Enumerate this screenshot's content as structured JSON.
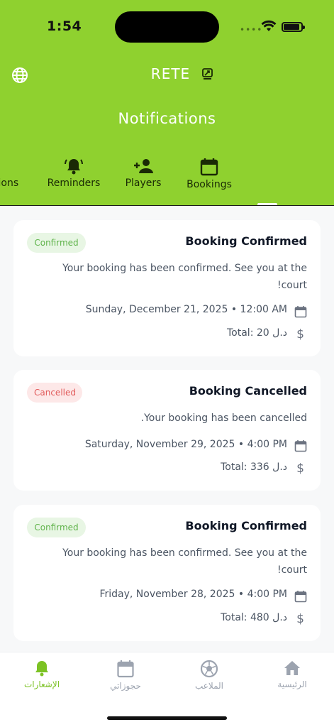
{
  "status_bar": {
    "time": "1:54"
  },
  "header": {
    "app_title": "RETE",
    "page_title": "Notifications",
    "accent_color": "#8fd12f"
  },
  "tabs": [
    {
      "label": "tions",
      "icon": "notifications-icon",
      "partial": true
    },
    {
      "label": "Reminders",
      "icon": "bell-ring-icon"
    },
    {
      "label": "Players",
      "icon": "person-add-icon"
    },
    {
      "label": "Bookings",
      "icon": "calendar-icon"
    }
  ],
  "notifications": [
    {
      "badge": "Confirmed",
      "title": "Booking Confirmed",
      "message": "Your booking has been confirmed. See you at the court!",
      "date": "Sunday, December 21, 2025 • 12:00 AM",
      "total": "Total: 20 د.ل"
    },
    {
      "badge": "Cancelled",
      "title": "Booking Cancelled",
      "message": "Your booking has been cancelled.",
      "date": "Saturday, November 29, 2025 • 4:00 PM",
      "total": "Total: 336 د.ل"
    },
    {
      "badge": "Confirmed",
      "title": "Booking Confirmed",
      "message": "Your booking has been confirmed. See you at the court!",
      "date": "Friday, November 28, 2025 • 4:00 PM",
      "total": "Total: 480 د.ل"
    }
  ],
  "bottom_nav": [
    {
      "label": "الإشعارات",
      "icon": "bell-icon",
      "active": true
    },
    {
      "label": "حجوزاتي",
      "icon": "calendar-icon"
    },
    {
      "label": "الملاعب",
      "icon": "soccer-ball-icon"
    },
    {
      "label": "الرئيسية",
      "icon": "home-icon"
    }
  ]
}
